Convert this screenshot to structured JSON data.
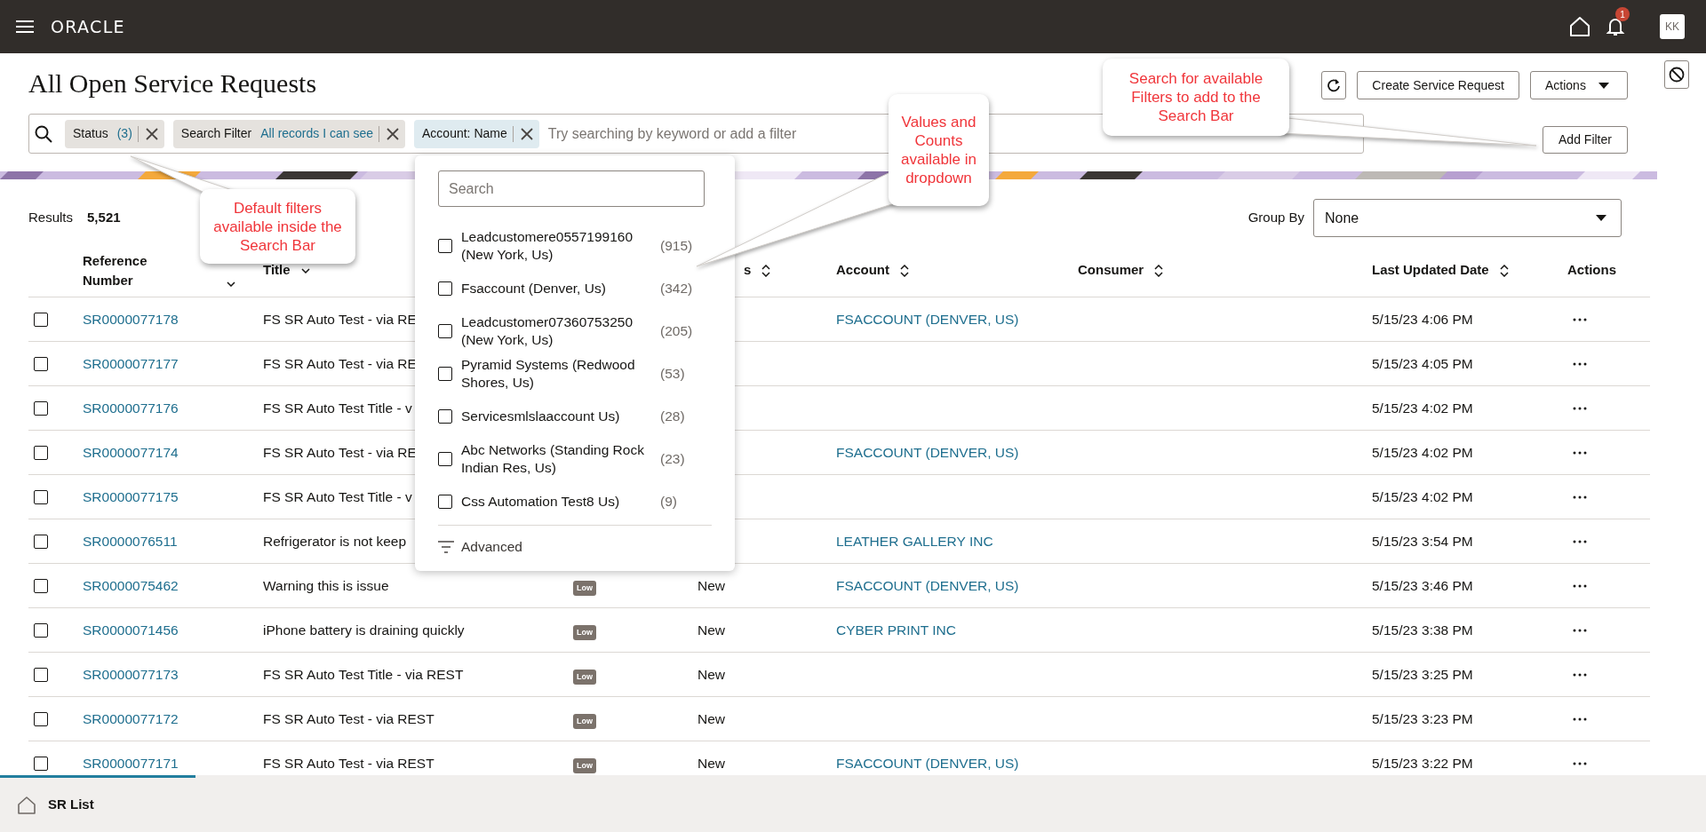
{
  "header": {
    "brand": "ORACLE",
    "notification_count": "1",
    "avatar": "KK"
  },
  "page": {
    "title": "All Open Service Requests",
    "buttons": [
      {
        "label": "Create Service Request",
        "kind": "plain"
      },
      {
        "label": "Actions",
        "kind": "menu"
      }
    ],
    "add_filter": "Add Filter"
  },
  "search_bar": {
    "chips": [
      {
        "label": "Status",
        "value": "(3)",
        "selected": false
      },
      {
        "label": "Search Filter",
        "value": "All records I can see",
        "selected": false
      },
      {
        "label": "Account: Name",
        "selected": true
      }
    ],
    "placeholder": "Try searching by keyword or add a filter"
  },
  "results": {
    "label": "Results",
    "count": "5,521"
  },
  "group_by": {
    "label": "Group By",
    "value": "None"
  },
  "table": {
    "columns": [
      {
        "label": "Reference Number",
        "kind": "chevron"
      },
      {
        "label": "Title",
        "kind": "chevron"
      },
      {
        "label": "s",
        "kind": "updown"
      },
      {
        "label": "Account",
        "kind": "updown"
      },
      {
        "label": "Consumer",
        "kind": "updown"
      },
      {
        "label": "Last Updated Date",
        "kind": "updown"
      },
      {
        "label": "Actions",
        "kind": "plain"
      }
    ],
    "rows": [
      {
        "checked": false,
        "reference": "SR0000077178",
        "title": "FS SR Auto Test - via RE",
        "account": "FSACCOUNT (DENVER, US)",
        "updated": "5/15/23 4:06 PM"
      },
      {
        "checked": false,
        "reference": "SR0000077177",
        "title": "FS SR Auto Test - via RE",
        "updated": "5/15/23 4:05 PM"
      },
      {
        "checked": false,
        "reference": "SR0000077176",
        "title": "FS SR Auto Test Title - v",
        "updated": "5/15/23 4:02 PM"
      },
      {
        "checked": false,
        "reference": "SR0000077174",
        "title": "FS SR Auto Test - via RE",
        "account": "FSACCOUNT (DENVER, US)",
        "updated": "5/15/23 4:02 PM"
      },
      {
        "checked": false,
        "reference": "SR0000077175",
        "title": "FS SR Auto Test Title - v",
        "updated": "5/15/23 4:02 PM"
      },
      {
        "checked": false,
        "reference": "SR0000076511",
        "title": "Refrigerator is not keep",
        "account": "LEATHER GALLERY INC",
        "updated": "5/15/23 3:54 PM"
      },
      {
        "checked": false,
        "reference": "SR0000075462",
        "title": "Warning this is issue",
        "priority": "Low",
        "status": "New",
        "account": "FSACCOUNT (DENVER, US)",
        "updated": "5/15/23 3:46 PM"
      },
      {
        "checked": false,
        "reference": "SR0000071456",
        "title": "iPhone battery is draining quickly",
        "priority": "Low",
        "status": "New",
        "account": "CYBER PRINT INC",
        "updated": "5/15/23 3:38 PM"
      },
      {
        "checked": false,
        "reference": "SR0000077173",
        "title": "FS SR Auto Test Title - via REST",
        "priority": "Low",
        "status": "New",
        "updated": "5/15/23 3:25 PM"
      },
      {
        "checked": false,
        "reference": "SR0000077172",
        "title": "FS SR Auto Test - via REST",
        "priority": "Low",
        "status": "New",
        "updated": "5/15/23 3:23 PM"
      },
      {
        "checked": false,
        "reference": "SR0000077171",
        "title": "FS SR Auto Test - via REST",
        "priority": "Low",
        "status": "New",
        "account": "FSACCOUNT (DENVER, US)",
        "updated": "5/15/23 3:22 PM"
      }
    ]
  },
  "dropdown": {
    "search_placeholder": "Search",
    "options": [
      {
        "label": "Leadcustomere0557199160 (New York, Us)",
        "count": "(915)",
        "checked": false
      },
      {
        "label": "Fsaccount (Denver, Us)",
        "count": "(342)",
        "checked": false
      },
      {
        "label": "Leadcustomer07360753250 (New York, Us)",
        "count": "(205)",
        "checked": false
      },
      {
        "label": "Pyramid Systems (Redwood Shores, Us)",
        "count": "(53)",
        "checked": false
      },
      {
        "label": "Servicesmlslaaccount Us)",
        "count": "(28)",
        "checked": false
      },
      {
        "label": "Abc Networks (Standing Rock Indian Res, Us)",
        "count": "(23)",
        "checked": false
      },
      {
        "label": "Css Automation Test8 Us)",
        "count": "(9)",
        "checked": false
      }
    ],
    "advanced": "Advanced"
  },
  "callouts": [
    {
      "text": "Default filters available inside the Search Bar"
    },
    {
      "text": "Values and Counts available in dropdown"
    },
    {
      "text": "Search for available Filters to add to the Search Bar"
    }
  ],
  "bottom_bar": {
    "tabs": [
      {
        "label": "SR List",
        "selected": true
      }
    ]
  }
}
